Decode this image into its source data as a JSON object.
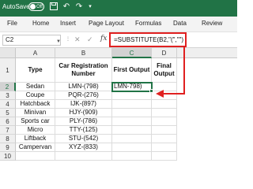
{
  "titlebar": {
    "autosave_label": "AutoSave",
    "toggle_state": "Off",
    "quick_access_icons": [
      "save-icon",
      "undo-icon",
      "redo-icon"
    ],
    "color": "#217346"
  },
  "ribbon": {
    "tabs": [
      "File",
      "Home",
      "Insert",
      "Page Layout",
      "Formulas",
      "Data",
      "Review"
    ]
  },
  "formula_bar": {
    "name_box": "C2",
    "formula": "=SUBSTITUTE(B2,\"(\",\"\")"
  },
  "grid": {
    "columns": [
      "A",
      "B",
      "C",
      "D"
    ],
    "rows": [
      "1",
      "2",
      "3",
      "4",
      "5",
      "6",
      "7",
      "8",
      "9",
      "10"
    ],
    "headers": {
      "type": "Type",
      "car_reg": "Car Registration Number",
      "first_output": "First Output",
      "final_output": "Final Output"
    },
    "data": [
      {
        "type": "Sedan",
        "reg": "LMN-(798)",
        "first": "LMN-798)"
      },
      {
        "type": "Coupe",
        "reg": "PQR-(276)",
        "first": ""
      },
      {
        "type": "Hatchback",
        "reg": "IJK-(897)",
        "first": ""
      },
      {
        "type": "Minivan",
        "reg": "HJY-(909)",
        "first": ""
      },
      {
        "type": "Sports car",
        "reg": "PLY-(786)",
        "first": ""
      },
      {
        "type": "Micro",
        "reg": "TTY-(125)",
        "first": ""
      },
      {
        "type": "Liftback",
        "reg": "STU-(542)",
        "first": ""
      },
      {
        "type": "Campervan",
        "reg": "XYZ-(833)",
        "first": ""
      }
    ]
  },
  "colors": {
    "accent": "#217346",
    "annotation": "#e02020"
  }
}
